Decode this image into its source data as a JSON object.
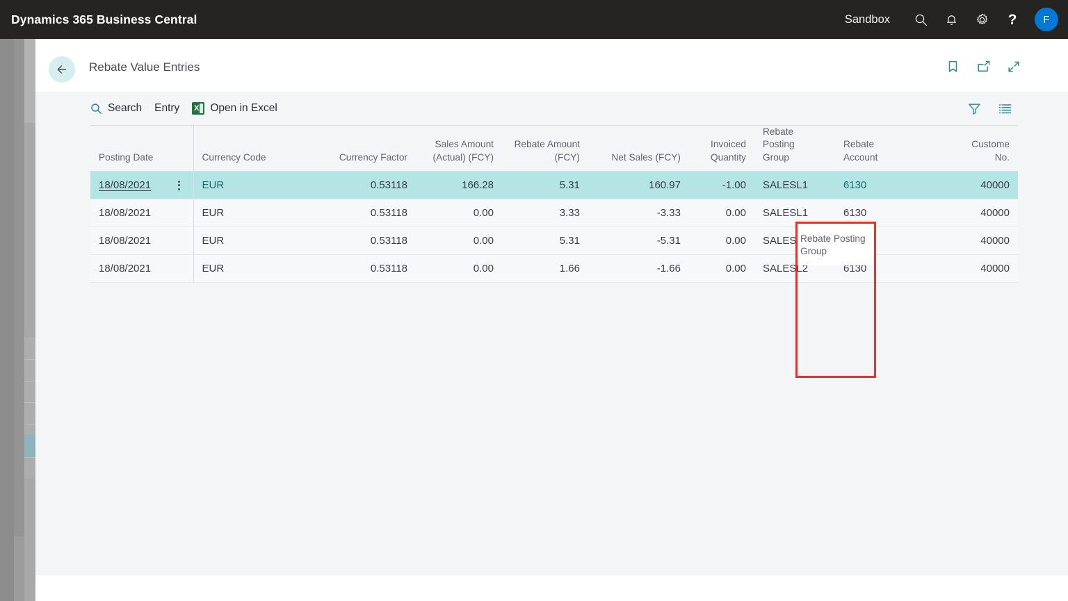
{
  "topbar": {
    "brand": "Dynamics 365 Business Central",
    "environment": "Sandbox",
    "search_icon": "search-icon",
    "notification_icon": "bell-icon",
    "settings_icon": "gear-icon",
    "help_label": "?",
    "avatar_initial": "F"
  },
  "page": {
    "back_label": "back-arrow",
    "title": "Rebate Value Entries",
    "icons": {
      "bookmark": "bookmark-icon",
      "open_new_window": "open-in-new-window-icon",
      "collapse": "collapse-icon"
    }
  },
  "toolbar": {
    "search_label": "Search",
    "entry_label": "Entry",
    "excel_label": "Open in Excel",
    "excel_glyph": "X",
    "filter_icon": "filter-icon",
    "options_icon": "list-options-icon"
  },
  "table": {
    "columns": [
      {
        "label": "Posting Date",
        "align": "left",
        "sep": false
      },
      {
        "label": "Currency Code",
        "align": "left",
        "sep": true
      },
      {
        "label": "Currency Factor",
        "align": "right",
        "sep": false
      },
      {
        "label": "Sales Amount\n(Actual) (FCY)",
        "align": "right",
        "sep": false
      },
      {
        "label": "Rebate Amount\n(FCY)",
        "align": "right",
        "sep": false
      },
      {
        "label": "Net Sales (FCY)",
        "align": "right",
        "sep": false
      },
      {
        "label": "Invoiced\nQuantity",
        "align": "right",
        "sep": false
      },
      {
        "label": "Rebate Posting\nGroup",
        "align": "left",
        "sep": false
      },
      {
        "label": "Rebate\nAccount",
        "align": "left",
        "sep": false
      },
      {
        "label": "Custome\nNo.",
        "align": "right",
        "sep": false
      }
    ],
    "rows": [
      {
        "selected": true,
        "posting_date": "18/08/2021",
        "currency_code": "EUR",
        "currency_factor": "0.53118",
        "sales_amount_actual_fcy": "166.28",
        "rebate_amount_fcy": "5.31",
        "net_sales_fcy": "160.97",
        "invoiced_quantity": "-1.00",
        "rebate_posting_group": "SALESL1",
        "rebate_account": "6130",
        "customer_no": "40000"
      },
      {
        "selected": false,
        "posting_date": "18/08/2021",
        "currency_code": "EUR",
        "currency_factor": "0.53118",
        "sales_amount_actual_fcy": "0.00",
        "rebate_amount_fcy": "3.33",
        "net_sales_fcy": "-3.33",
        "invoiced_quantity": "0.00",
        "rebate_posting_group": "SALESL1",
        "rebate_account": "6130",
        "customer_no": "40000"
      },
      {
        "selected": false,
        "posting_date": "18/08/2021",
        "currency_code": "EUR",
        "currency_factor": "0.53118",
        "sales_amount_actual_fcy": "0.00",
        "rebate_amount_fcy": "5.31",
        "net_sales_fcy": "-5.31",
        "invoiced_quantity": "0.00",
        "rebate_posting_group": "SALESL2",
        "rebate_account": "6130",
        "customer_no": "40000"
      },
      {
        "selected": false,
        "posting_date": "18/08/2021",
        "currency_code": "EUR",
        "currency_factor": "0.53118",
        "sales_amount_actual_fcy": "0.00",
        "rebate_amount_fcy": "1.66",
        "net_sales_fcy": "-1.66",
        "invoiced_quantity": "0.00",
        "rebate_posting_group": "SALESL2",
        "rebate_account": "6130",
        "customer_no": "40000"
      }
    ]
  },
  "annotation": {
    "highlight_column": "Rebate Posting Group",
    "highlight_color": "#ee3124"
  },
  "colors": {
    "topbar_bg": "#252423",
    "accent_teal": "#2a8c92",
    "selected_row": "#b3e5e5",
    "avatar_blue": "#0078d4",
    "excel_green": "#217346"
  }
}
